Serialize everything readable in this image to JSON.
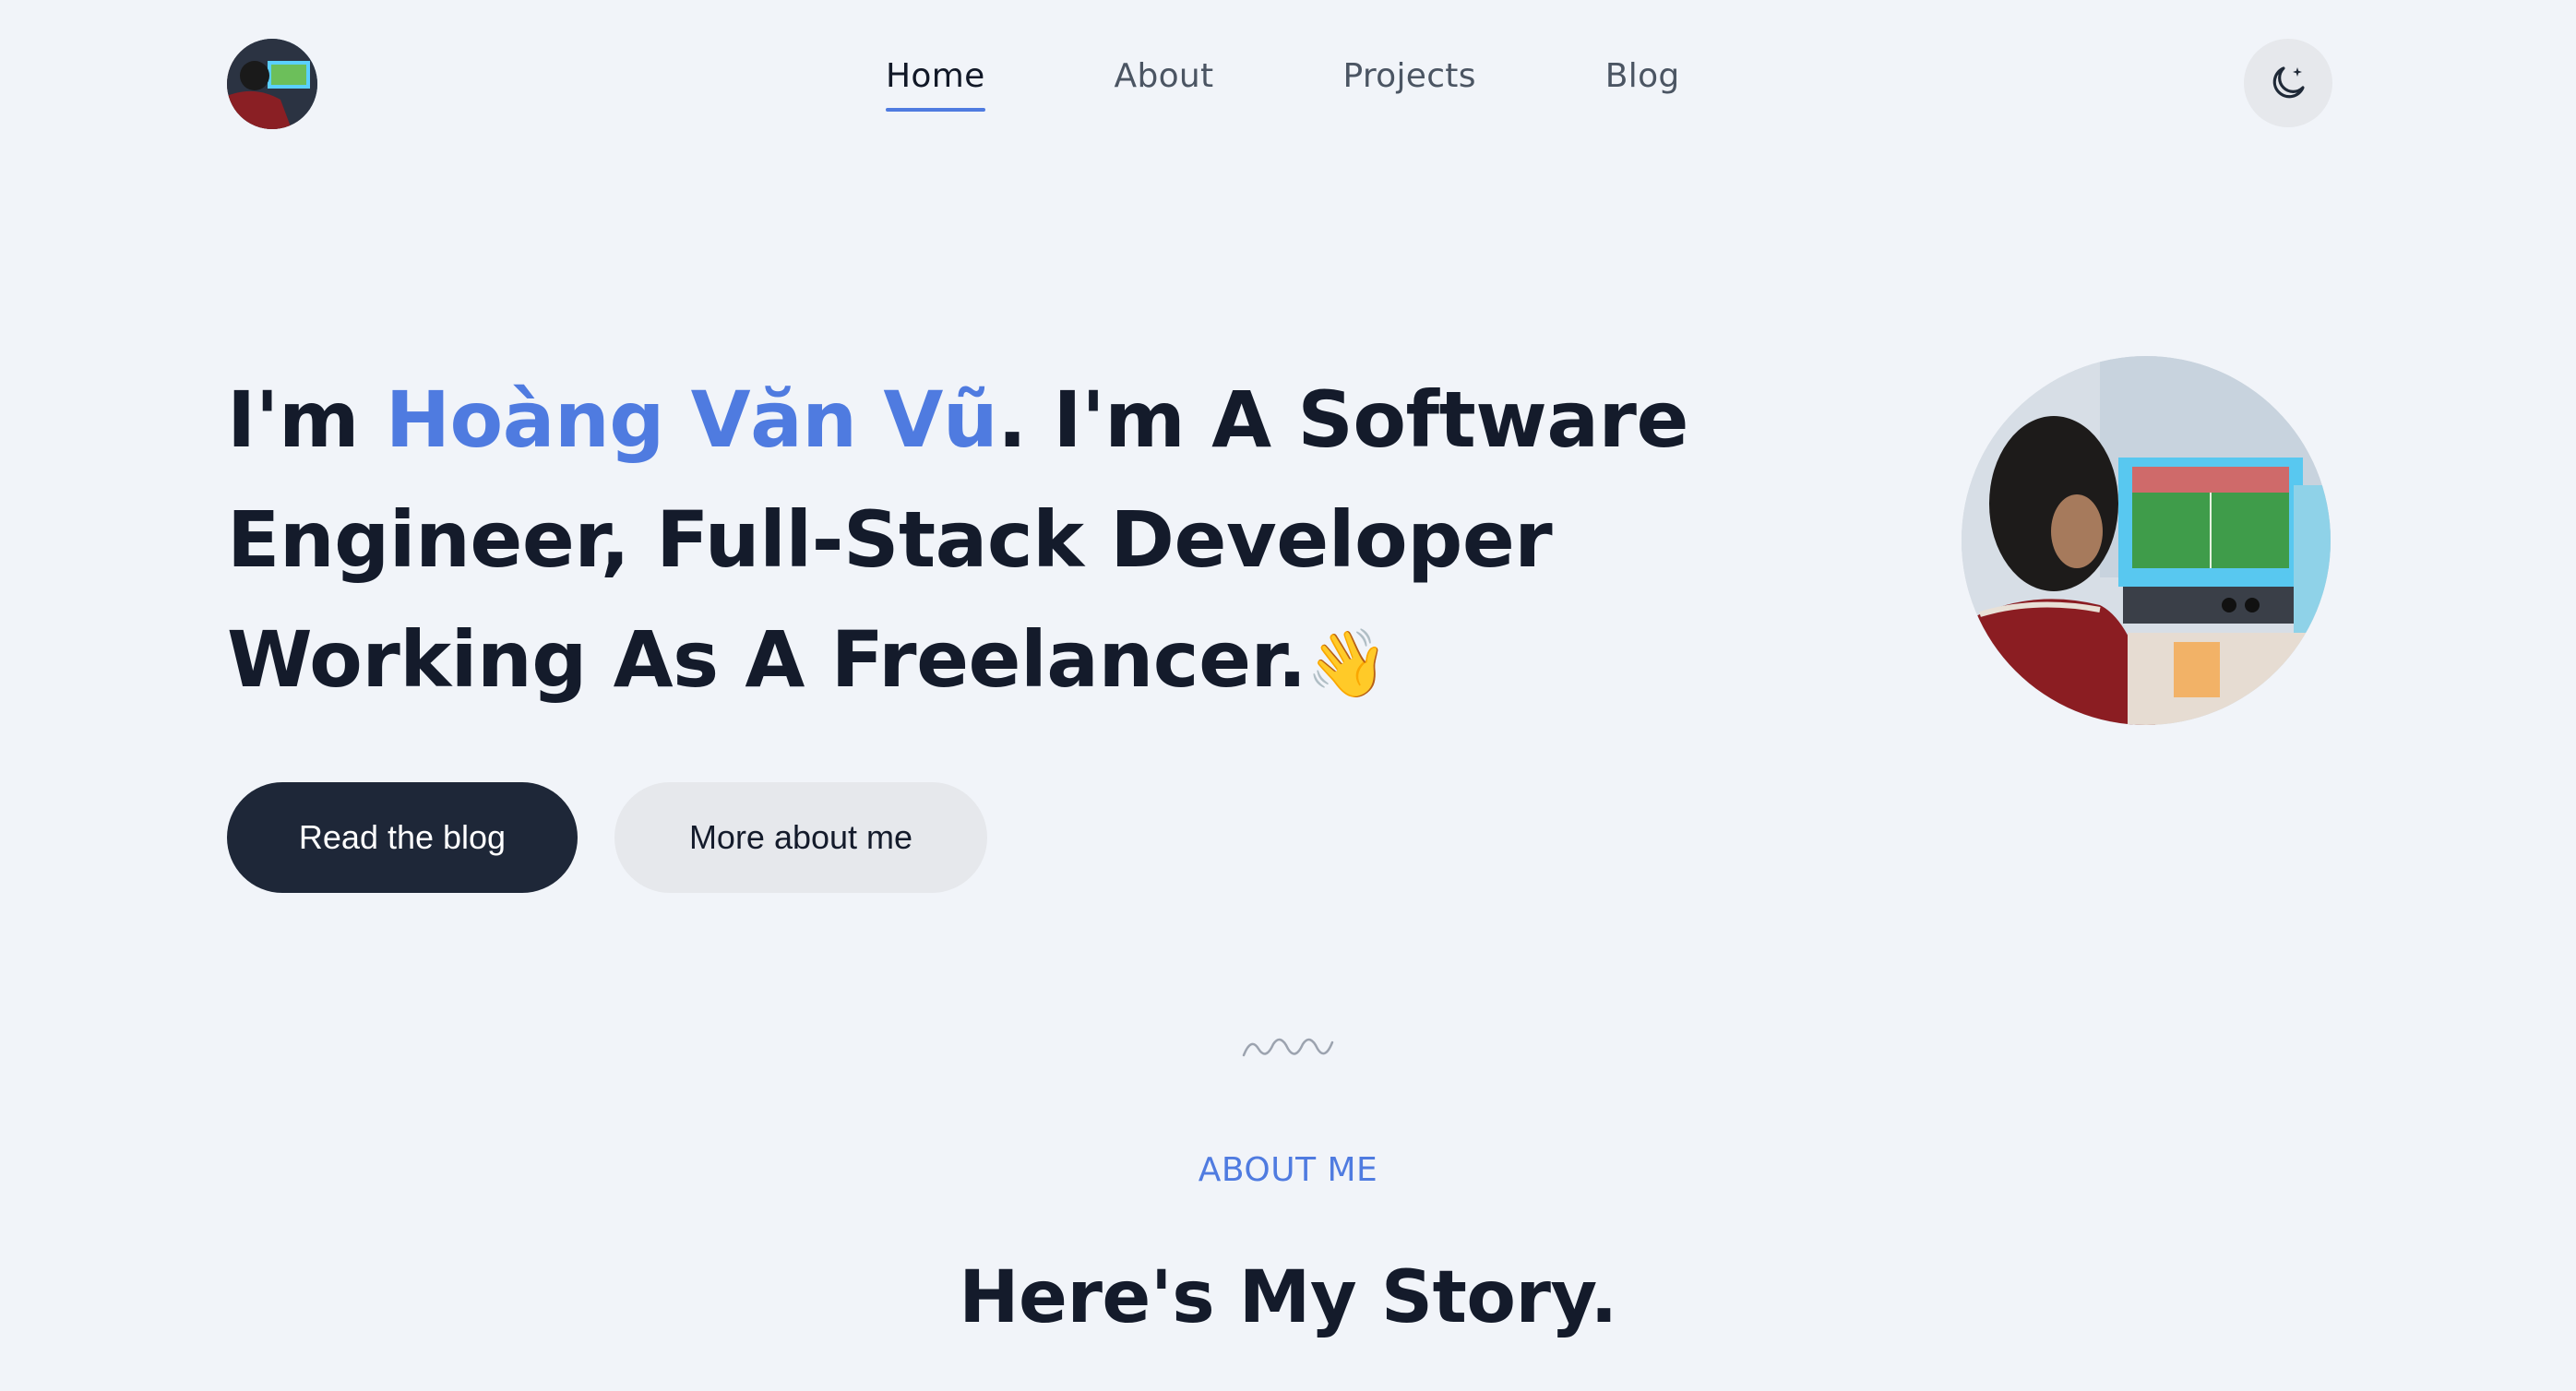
{
  "header": {
    "nav": [
      {
        "label": "Home",
        "active": true
      },
      {
        "label": "About",
        "active": false
      },
      {
        "label": "Projects",
        "active": false
      },
      {
        "label": "Blog",
        "active": false
      }
    ],
    "theme_toggle_icon": "moon-star-icon"
  },
  "hero": {
    "intro_prefix": "I'm ",
    "name": "Hoàng Văn Vũ",
    "intro_suffix": ". I'm A Software Engineer, Full-Stack Developer Working As A Freelancer.",
    "wave_emoji": "👋",
    "primary_button": "Read the blog",
    "secondary_button": "More about me"
  },
  "about": {
    "label": "ABOUT ME",
    "title": "Here's My Story."
  },
  "colors": {
    "accent": "#4f7be0",
    "dark": "#1e2738",
    "background": "#f1f4f9"
  }
}
